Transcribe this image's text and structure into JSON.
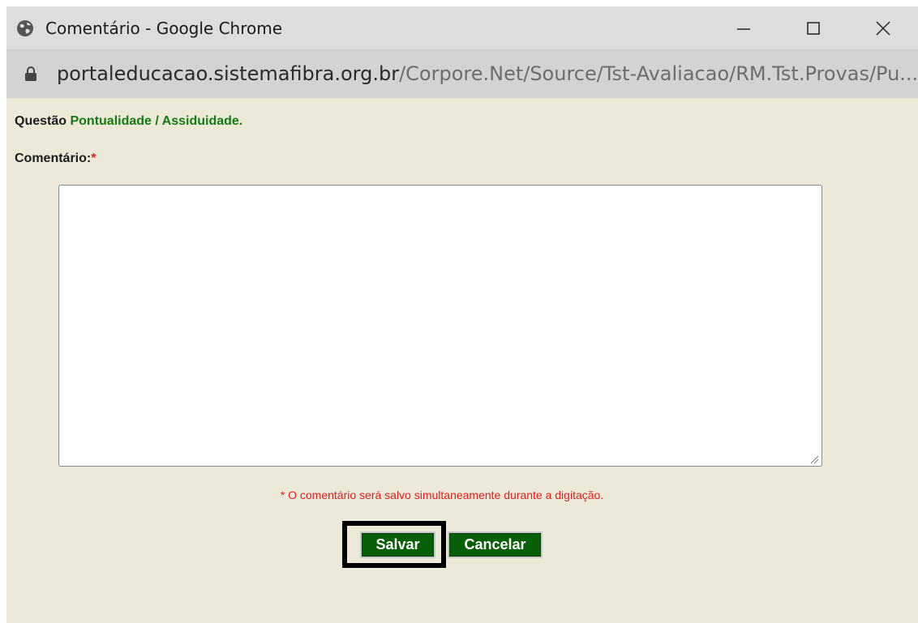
{
  "window": {
    "title": "Comentário - Google Chrome",
    "icon": "globe-icon",
    "controls": [
      "minimize-icon",
      "maximize-icon",
      "close-icon"
    ]
  },
  "address_bar": {
    "host": "portaleducacao.sistemafibra.org.br",
    "path": "/Corpore.Net/Source/Tst-Avaliacao/RM.Tst.Provas/Pu..."
  },
  "form": {
    "question_label": "Questão",
    "question_title": "Pontualidade / Assiduidade.",
    "comment_label": "Comentário:",
    "required_mark": "*",
    "comment_value": "",
    "note": "* O comentário será salvo simultaneamente durante a digitação.",
    "save_label": "Salvar",
    "cancel_label": "Cancelar"
  },
  "colors": {
    "background": "#ece9d8",
    "button": "#075f07",
    "question_title": "#157a15",
    "required": "#e02020"
  }
}
